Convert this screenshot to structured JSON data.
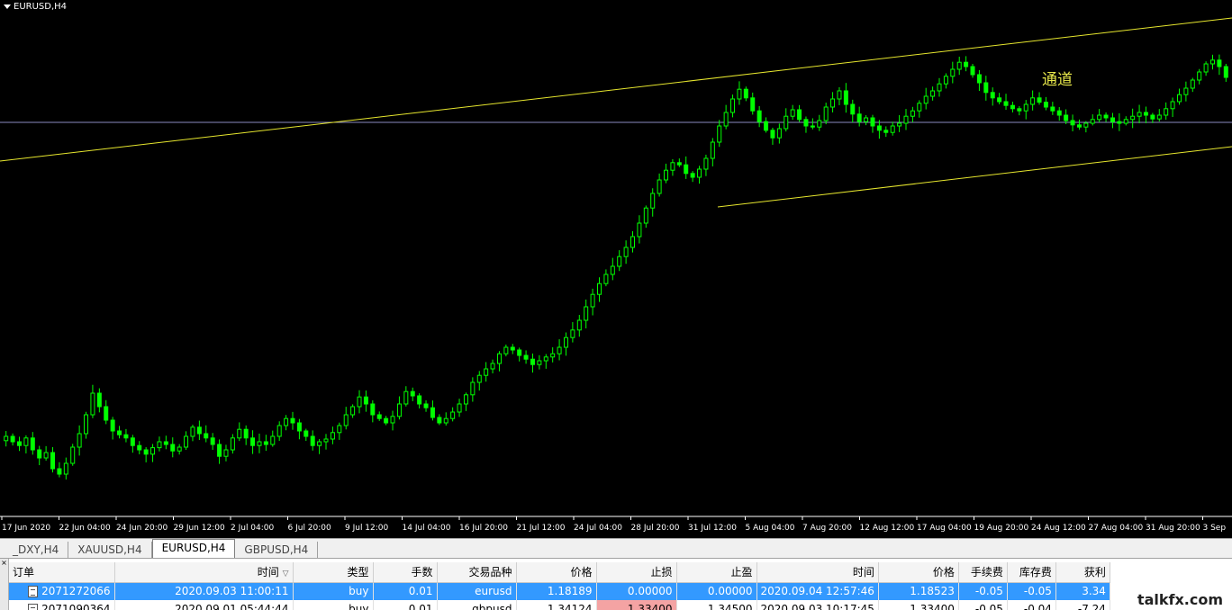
{
  "chart": {
    "symbol_title": "EURUSD,H4",
    "annotation": "通道",
    "x_ticks": [
      "17 Jun 2020",
      "22 Jun 04:00",
      "24 Jun 20:00",
      "29 Jun 12:00",
      "2 Jul 04:00",
      "6 Jul 20:00",
      "9 Jul 12:00",
      "14 Jul 04:00",
      "16 Jul 20:00",
      "21 Jul 12:00",
      "24 Jul 04:00",
      "28 Jul 20:00",
      "31 Jul 12:00",
      "5 Aug 04:00",
      "7 Aug 20:00",
      "12 Aug 12:00",
      "17 Aug 04:00",
      "19 Aug 20:00",
      "24 Aug 12:00",
      "27 Aug 04:00",
      "31 Aug 20:00",
      "3 Sep"
    ],
    "colors": {
      "background": "#000000",
      "candle": "#00ff00",
      "channel": "#e6e62e",
      "hline": "#8a8ac0",
      "axis": "#ffffff"
    }
  },
  "chart_data": {
    "type": "candlestick",
    "symbol": "EURUSD",
    "timeframe": "H4",
    "closes": [
      1.1265,
      1.1255,
      1.1248,
      1.1262,
      1.124,
      1.1225,
      1.1235,
      1.1205,
      1.1195,
      1.1215,
      1.1245,
      1.127,
      1.1305,
      1.1345,
      1.132,
      1.1295,
      1.1275,
      1.1268,
      1.1262,
      1.1248,
      1.124,
      1.1232,
      1.1244,
      1.1255,
      1.125,
      1.1238,
      1.1245,
      1.1265,
      1.1282,
      1.127,
      1.1262,
      1.125,
      1.1228,
      1.124,
      1.1262,
      1.1278,
      1.1262,
      1.1248,
      1.1255,
      1.125,
      1.1265,
      1.1285,
      1.1298,
      1.129,
      1.1275,
      1.1265,
      1.1248,
      1.1255,
      1.126,
      1.1272,
      1.1285,
      1.1305,
      1.132,
      1.1338,
      1.1325,
      1.1305,
      1.1298,
      1.129,
      1.1302,
      1.1325,
      1.1348,
      1.134,
      1.1325,
      1.1318,
      1.13,
      1.129,
      1.1298,
      1.131,
      1.1325,
      1.1342,
      1.1365,
      1.1378,
      1.139,
      1.14,
      1.1418,
      1.143,
      1.1425,
      1.1415,
      1.1408,
      1.1398,
      1.1405,
      1.1412,
      1.1418,
      1.143,
      1.1448,
      1.1462,
      1.148,
      1.1505,
      1.1528,
      1.1548,
      1.1565,
      1.158,
      1.1598,
      1.1615,
      1.1635,
      1.166,
      1.1688,
      1.1715,
      1.174,
      1.1758,
      1.1772,
      1.1768,
      1.1752,
      1.1745,
      1.176,
      1.178,
      1.181,
      1.184,
      1.1865,
      1.189,
      1.1908,
      1.1892,
      1.1868,
      1.1848,
      1.1832,
      1.1818,
      1.1835,
      1.1858,
      1.187,
      1.1852,
      1.184,
      1.1838,
      1.185,
      1.1875,
      1.189,
      1.1905,
      1.188,
      1.1862,
      1.1848,
      1.1855,
      1.184,
      1.1832,
      1.1828,
      1.184,
      1.1845,
      1.1858,
      1.1868,
      1.1882,
      1.1895,
      1.1905,
      1.1918,
      1.1932,
      1.1945,
      1.1958,
      1.195,
      1.1935,
      1.192,
      1.1902,
      1.1892,
      1.1885,
      1.1878,
      1.1872,
      1.1868,
      1.188,
      1.1892,
      1.1884,
      1.1875,
      1.1868,
      1.186,
      1.185,
      1.1842,
      1.1838,
      1.1845,
      1.1852,
      1.186,
      1.1855,
      1.1848,
      1.1845,
      1.1852,
      1.1858,
      1.1865,
      1.186,
      1.1853,
      1.186,
      1.1872,
      1.1885,
      1.1898,
      1.191,
      1.1925,
      1.194,
      1.1955,
      1.1962,
      1.195,
      1.193
    ],
    "channel_lines": true,
    "horizontal_line": true
  },
  "tabs": [
    {
      "label": "_DXY,H4",
      "active": false
    },
    {
      "label": "XAUUSD,H4",
      "active": false
    },
    {
      "label": "EURUSD,H4",
      "active": true
    },
    {
      "label": "GBPUSD,H4",
      "active": false
    }
  ],
  "orders": {
    "headers": [
      "订单",
      "时间",
      "类型",
      "手数",
      "交易品种",
      "价格",
      "止损",
      "止盈",
      "时间",
      "价格",
      "手续费",
      "库存费",
      "获利"
    ],
    "sort_indicator": "▽",
    "rows": [
      [
        "2071272066",
        "2020.09.03 11:00:11",
        "buy",
        "0.01",
        "eurusd",
        "1.18189",
        "0.00000",
        "0.00000",
        "2020.09.04 12:57:46",
        "1.18523",
        "-0.05",
        "-0.05",
        "3.34"
      ],
      [
        "2071090364",
        "2020.09.01 05:44:44",
        "buy",
        "0.01",
        "gbpusd",
        "1.34124",
        "1.33400",
        "1.34500",
        "2020.09.03 10:17:45",
        "1.33400",
        "-0.05",
        "-0.04",
        "-7.24"
      ]
    ]
  },
  "side_label": "×",
  "watermark": "talkfx.com"
}
